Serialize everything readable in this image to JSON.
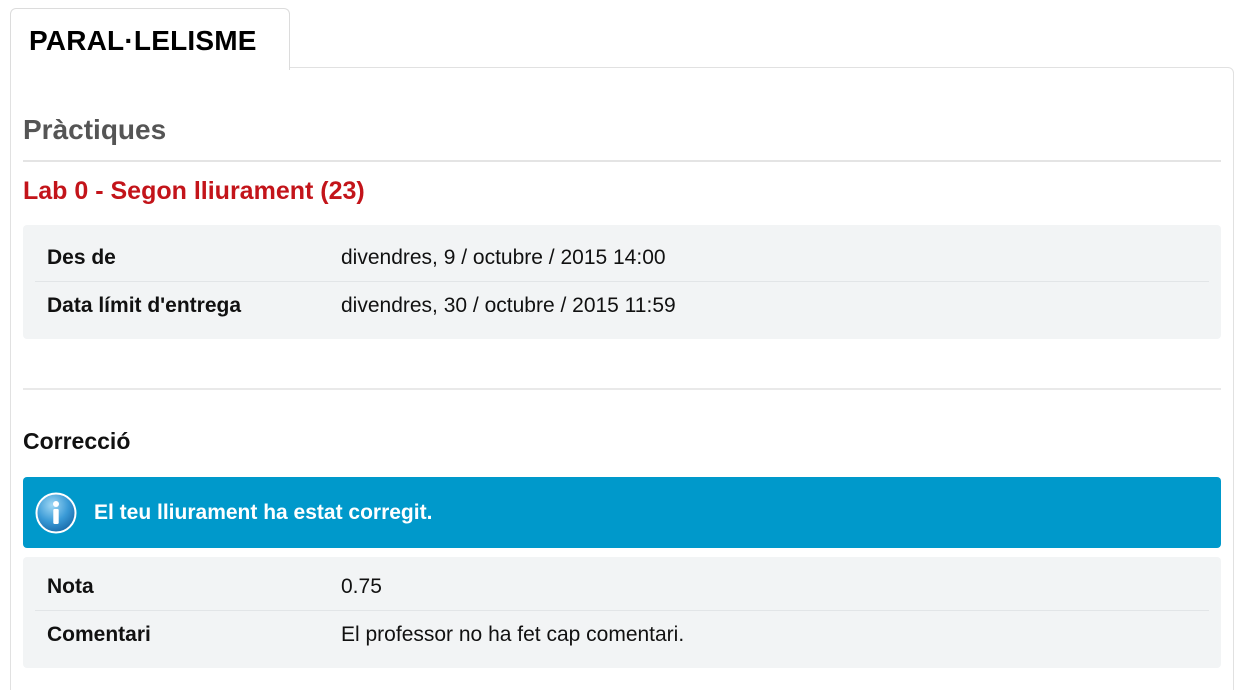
{
  "tab": {
    "label": "PARAL·LELISME"
  },
  "section": {
    "title": "Pràctiques"
  },
  "assignment": {
    "title": "Lab 0 - Segon lliurament (23)",
    "dates": [
      {
        "label": "Des de",
        "value": "divendres, 9 / octubre / 2015 14:00"
      },
      {
        "label": "Data límit d'entrega",
        "value": "divendres, 30 / octubre / 2015 11:59"
      }
    ]
  },
  "correction": {
    "title": "Correcció",
    "alert": {
      "icon": "info-icon",
      "text": "El teu lliurament ha estat corregit.",
      "color": "#0099cb"
    },
    "fields": [
      {
        "label": "Nota",
        "value": "0.75"
      },
      {
        "label": "Comentari",
        "value": "El professor no ha fet cap comentari."
      }
    ]
  },
  "colors": {
    "accent_red": "#c3141a",
    "box_bg": "#f2f4f5",
    "section_grey": "#555555"
  }
}
